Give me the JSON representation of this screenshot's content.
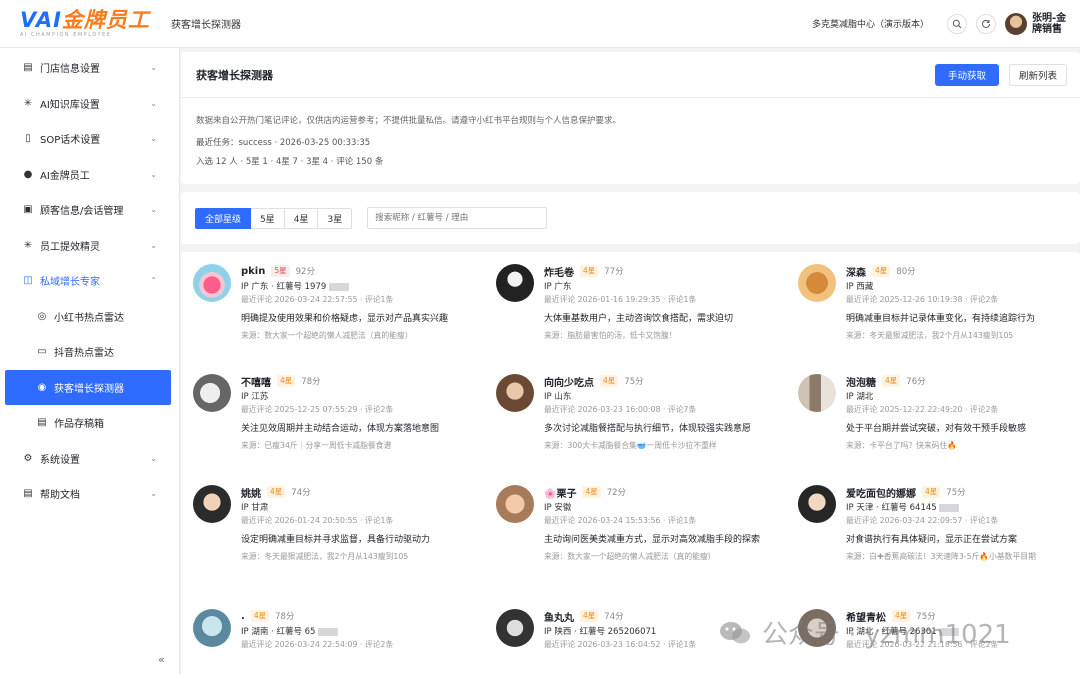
{
  "header": {
    "logo_text_v": "VAI",
    "logo_text_main": "金牌员工",
    "logo_sub": "AI CHAMPION EMPLOYEE",
    "page_name": "获客增长探测器",
    "store_name": "多克莫减脂中心（演示版本）",
    "user_name": "张明-金牌销售"
  },
  "sidebar": {
    "items": [
      {
        "label": "门店信息设置",
        "icon": "store-icon",
        "chevron": "⌄"
      },
      {
        "label": "AI知识库设置",
        "icon": "spark-icon",
        "chevron": "⌄"
      },
      {
        "label": "SOP话术设置",
        "icon": "phone-icon",
        "chevron": "⌄"
      },
      {
        "label": "AI金牌员工",
        "icon": "user-icon",
        "chevron": "⌄"
      },
      {
        "label": "顾客信息/会话管理",
        "icon": "customer-icon",
        "chevron": "⌄"
      },
      {
        "label": "员工提效精灵",
        "icon": "spark-icon",
        "chevron": "⌄"
      },
      {
        "label": "私域增长专家",
        "icon": "growth-icon",
        "chevron": "⌃"
      }
    ],
    "subitems": [
      {
        "label": "小红书热点雷达",
        "icon": "radar-icon"
      },
      {
        "label": "抖音热点雷达",
        "icon": "video-icon"
      },
      {
        "label": "获客增长探测器",
        "icon": "detector-icon"
      },
      {
        "label": "作品存稿箱",
        "icon": "draft-icon"
      }
    ],
    "bottom_items": [
      {
        "label": "系统设置",
        "icon": "gear-icon",
        "chevron": "⌄"
      },
      {
        "label": "帮助文档",
        "icon": "doc-icon",
        "chevron": "⌄"
      }
    ],
    "collapse_glyph": "«"
  },
  "summary": {
    "title": "获客增长探测器",
    "fetch_btn": "手动获取",
    "refresh_btn": "刷新列表",
    "notice": "数据来自公开热门笔记评论，仅供店内运营参考；不提供批量私信。请遵守小红书平台规则与个人信息保护要求。",
    "last_task": "最近任务：success · 2026-03-25 00:33:35",
    "stats": "入选 12 人 · 5星 1 · 4星 7 · 3星 4 · 评论 150 条"
  },
  "filter": {
    "tabs": [
      "全部星级",
      "5星",
      "4星",
      "3星"
    ],
    "search_placeholder": "搜索昵称 / 红薯号 / 理由"
  },
  "cards": [
    {
      "name": "pkin",
      "stars": "5星",
      "level": 5,
      "score": "92分",
      "ip": "IP 广东 · 红薯号 1979",
      "masked": true,
      "time": "最近评论 2026-03-24 22:57:55 · 评论1条",
      "reason": "明确提及使用效果和价格疑虑，显示对产品真实兴趣",
      "source": "来源：数大家一个超绝的懒人减肥法（真的能瘦）"
    },
    {
      "name": "炸毛卷",
      "stars": "4星",
      "level": 4,
      "score": "77分",
      "ip": "IP 广东",
      "masked": false,
      "time": "最近评论 2026-01-16 19:29:35 · 评论1条",
      "reason": "大体重基数用户，主动咨询饮食搭配，需求迫切",
      "source": "来源：脂肪最害怕的汤，低卡又饱腹！"
    },
    {
      "name": "深森",
      "stars": "4星",
      "level": 4,
      "score": "80分",
      "ip": "IP 西藏",
      "masked": false,
      "time": "最近评论 2025-12-26 10:19:38 · 评论2条",
      "reason": "明确减重目标并记录体重变化，有持续追踪行为",
      "source": "来源：冬天最狠减肥法，我2个月从143瘦到105"
    },
    {
      "name": "不嘻嘻",
      "stars": "4星",
      "level": 4,
      "score": "78分",
      "ip": "IP 江苏",
      "masked": false,
      "time": "最近评论 2025-12-25 07:55:29 · 评论2条",
      "reason": "关注见效周期并主动结合运动，体现方案落地意图",
      "source": "来源：已瘦34斤｜分享一周低卡减脂餐食谱"
    },
    {
      "name": "向向少吃点",
      "stars": "4星",
      "level": 4,
      "score": "75分",
      "ip": "IP 山东",
      "masked": false,
      "time": "最近评论 2026-03-23 16:00:08 · 评论7条",
      "reason": "多次讨论减脂餐搭配与执行细节，体现较强实践意愿",
      "source": "来源：300大卡减脂餐合集🥣一周低卡沙拉不重样"
    },
    {
      "name": "泡泡糖",
      "stars": "4星",
      "level": 4,
      "score": "76分",
      "ip": "IP 湖北",
      "masked": false,
      "time": "最近评论 2025-12-22 22:49:20 · 评论2条",
      "reason": "处于平台期并尝试突破，对有效干预手段敏感",
      "source": "来源：卡平台了吗？快来码住🔥"
    },
    {
      "name": "姚姚",
      "stars": "4星",
      "level": 4,
      "score": "74分",
      "ip": "IP 甘肃",
      "masked": false,
      "time": "最近评论 2026-01-24 20:50:55 · 评论1条",
      "reason": "设定明确减重目标并寻求监督，具备行动驱动力",
      "source": "来源：冬天最狠减肥法，我2个月从143瘦到105"
    },
    {
      "name": "🌸栗子",
      "stars": "4星",
      "level": 4,
      "score": "72分",
      "ip": "IP 安徽",
      "masked": false,
      "time": "最近评论 2026-03-24 15:53:56 · 评论1条",
      "reason": "主动询问医美类减重方式，显示对高效减脂手段的探索",
      "source": "来源：数大家一个超绝的懒人减肥法（真的能瘦）"
    },
    {
      "name": "爱吃面包的娜娜",
      "stars": "4星",
      "level": 4,
      "score": "75分",
      "ip": "IP 天津 · 红薯号 64145",
      "masked": true,
      "time": "最近评论 2026-03-24 22:09:57 · 评论1条",
      "reason": "对食谱执行有具体疑问，显示正在尝试方案",
      "source": "来源：白✚香蕉高碳法！3天速降3-5斤🔥小基数平目期"
    },
    {
      "name": ".",
      "stars": "4星",
      "level": 4,
      "score": "78分",
      "ip": "IP 湖南 · 红薯号 65",
      "masked": true,
      "time": "最近评论 2026-03-24 22:54:09 · 评论2条",
      "reason": "",
      "source": ""
    },
    {
      "name": "鱼丸丸",
      "stars": "4星",
      "level": 4,
      "score": "74分",
      "ip": "IP 陕西 · 红薯号 265206071",
      "masked": false,
      "time": "最近评论 2026-03-23 16:04:52 · 评论1条",
      "reason": "",
      "source": ""
    },
    {
      "name": "希望青松",
      "stars": "4星",
      "level": 4,
      "score": "75分",
      "ip": "IP 湖北 · 红薯号 26301",
      "masked": true,
      "time": "最近评论 2026-03-22 21:18:56 · 评论2条",
      "reason": "",
      "source": ""
    }
  ],
  "watermark": {
    "text": "公众号 · yzmm1021"
  }
}
